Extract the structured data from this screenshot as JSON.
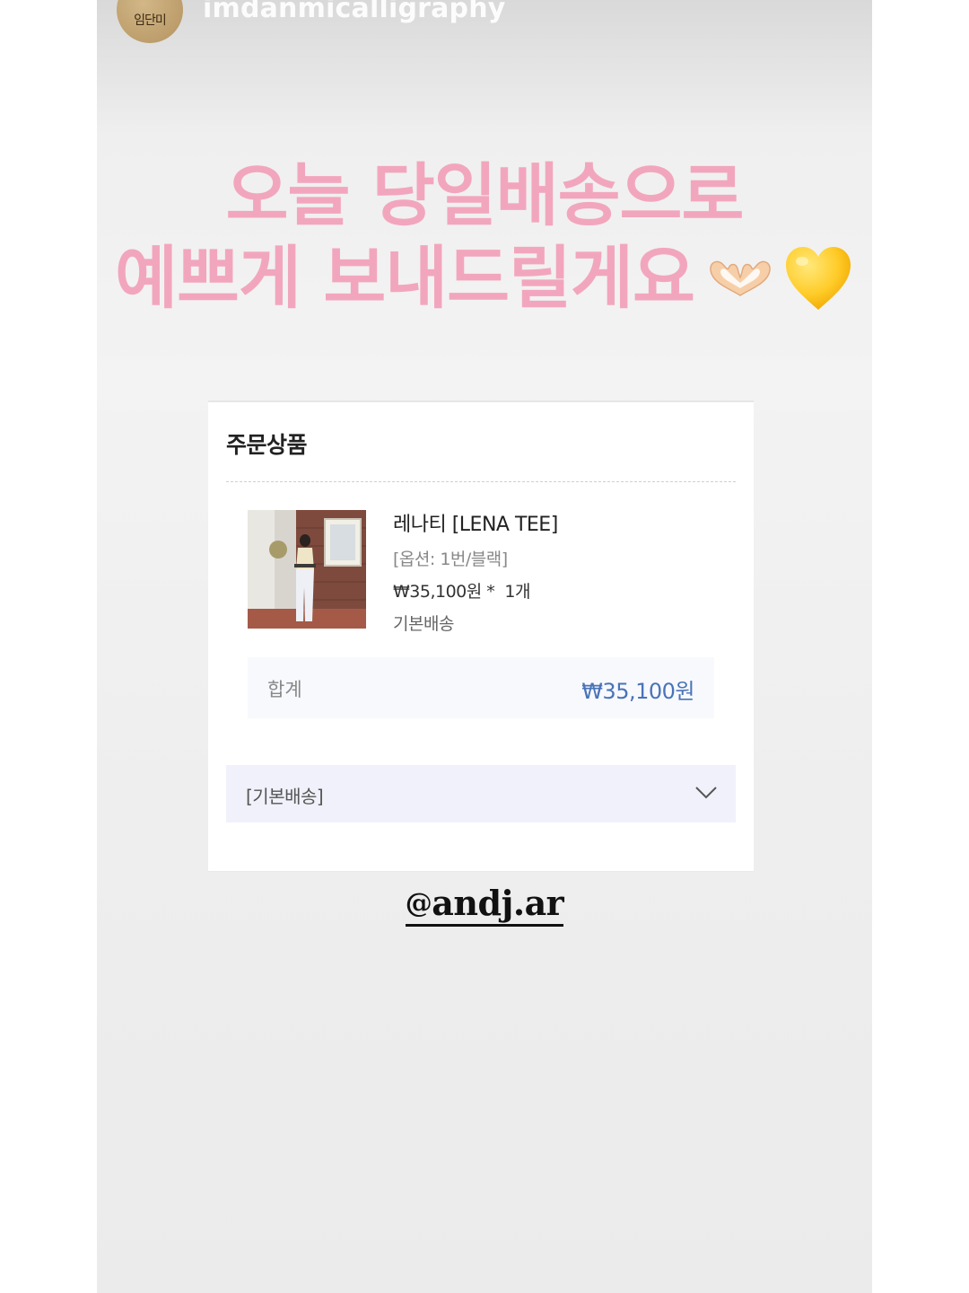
{
  "story": {
    "username": "imdanmicalligraphy",
    "avatar_text": "임단미",
    "headline_line1": "오늘 당일배송으로",
    "headline_line2": "예쁘게 보내드릴게요",
    "headline_color": "#f2a6bd",
    "emojis": [
      "heart-hands-icon",
      "yellow-heart-icon"
    ]
  },
  "order": {
    "section_title": "주문상품",
    "product": {
      "name": "레나티 [LENA TEE]",
      "option": "[옵션: 1번/블랙]",
      "price_qty": "₩35,100원 *  1개",
      "shipping": "기본배송"
    },
    "total": {
      "label": "합계",
      "value": "₩35,100원",
      "value_color": "#4a73b8"
    },
    "shipping_select": {
      "selected": "[기본배송]"
    }
  },
  "mention": {
    "at": "@",
    "handle": "andj.ar"
  }
}
